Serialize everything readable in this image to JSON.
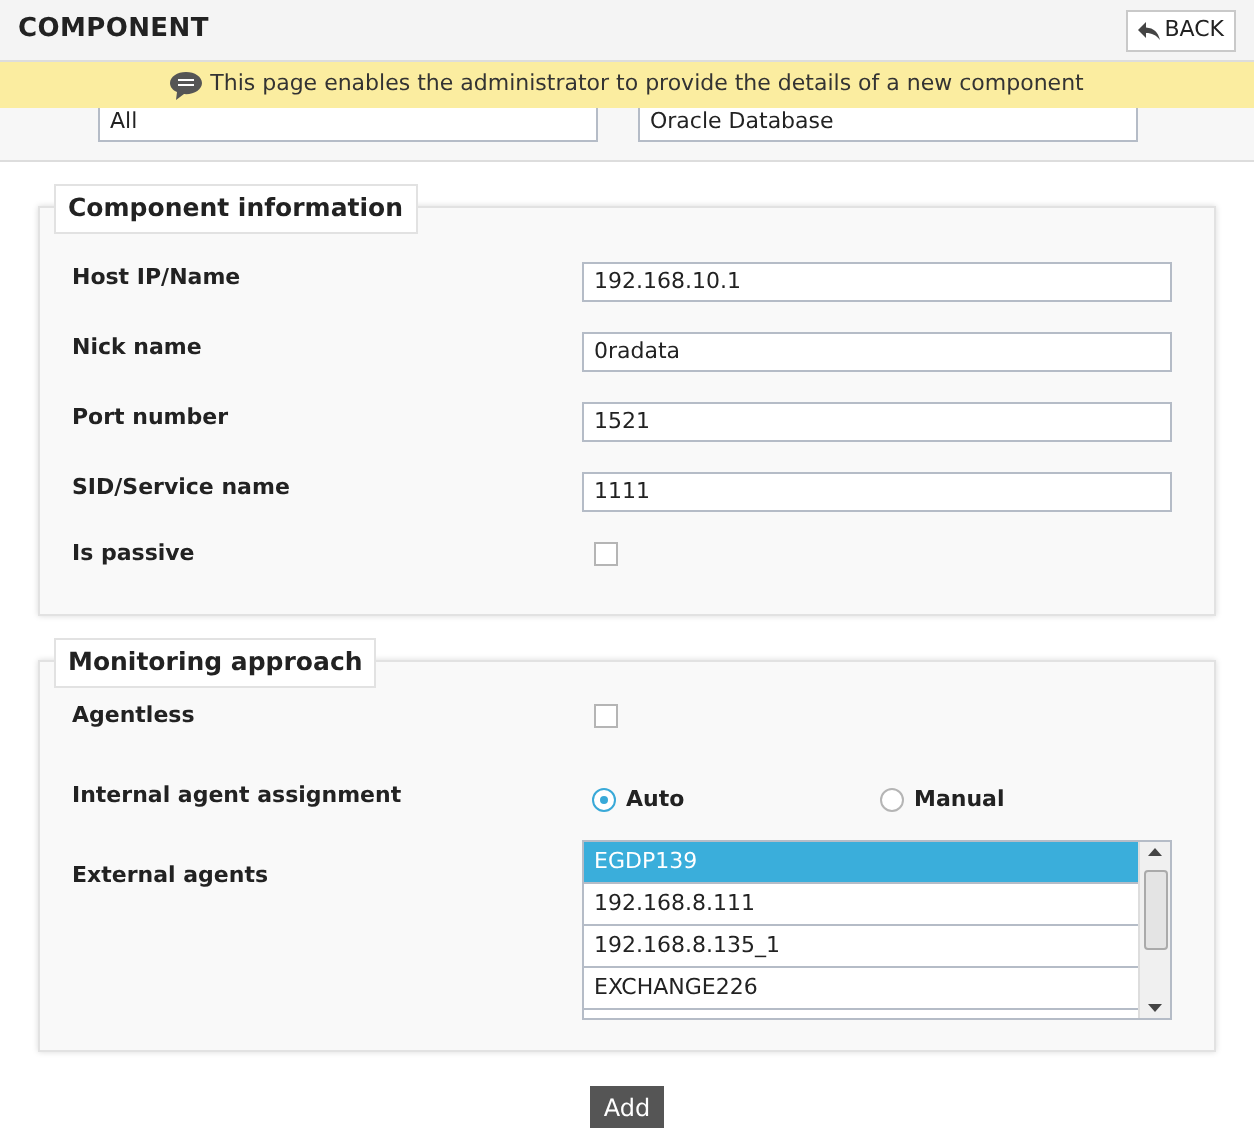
{
  "header": {
    "title": "COMPONENT",
    "back_button": "BACK"
  },
  "banner": {
    "text": "This page enables the administrator to provide the details of a new component"
  },
  "filters": [
    {
      "value": "All"
    },
    {
      "value": "Oracle Database"
    }
  ],
  "component_information": {
    "legend": "Component information",
    "fields": [
      {
        "kind": "text",
        "label": "Host IP/Name",
        "value": "192.168.10.1"
      },
      {
        "kind": "text",
        "label": "Nick name",
        "value": "0radata"
      },
      {
        "kind": "text",
        "label": "Port number",
        "value": "1521"
      },
      {
        "kind": "text",
        "label": "SID/Service name",
        "value": "1111"
      },
      {
        "kind": "checkbox",
        "label": "Is passive",
        "checked": false
      }
    ]
  },
  "monitoring_approach": {
    "legend": "Monitoring approach",
    "agentless": {
      "label": "Agentless",
      "checked": false
    },
    "internal_agent_assignment": {
      "label": "Internal agent assignment",
      "options": [
        {
          "label": "Auto",
          "selected": true
        },
        {
          "label": "Manual",
          "selected": false
        }
      ]
    },
    "external_agents": {
      "label": "External agents",
      "items": [
        {
          "label": "EGDP139",
          "selected": true
        },
        {
          "label": "192.168.8.111",
          "selected": false
        },
        {
          "label": "192.168.8.135_1",
          "selected": false
        },
        {
          "label": "EXCHANGE226",
          "selected": false
        }
      ]
    }
  },
  "add_button": "Add"
}
